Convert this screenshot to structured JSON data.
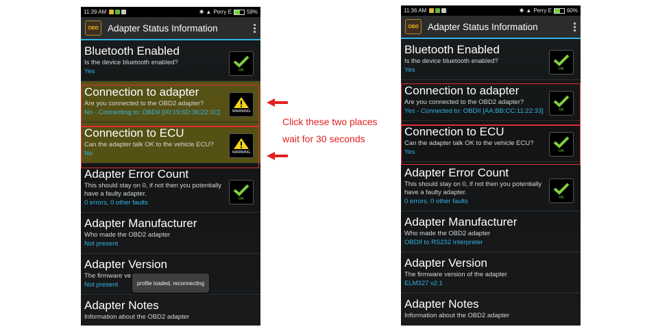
{
  "left_phone": {
    "statusbar": {
      "time": "11:39 AM",
      "carrier": "Perry E",
      "battery": "59%",
      "battery_level": 0.59
    },
    "actionbar": {
      "title": "Adapter Status Information",
      "logo_text": "OBD"
    },
    "rows": [
      {
        "title": "Bluetooth Enabled",
        "description": "Is the device bluetooth enabled?",
        "status": "Yes",
        "icon": "ok",
        "icon_label": "OK"
      },
      {
        "title": "Connection to adapter",
        "description": "Are you connected to the OBD2 adapter?",
        "status": "No - Connecting to: OBDII [00:19:6D:36:22:1C]",
        "icon": "warning",
        "icon_label": "WARNING"
      },
      {
        "title": "Connection to ECU",
        "description": "Can the adapter talk OK to the vehicle ECU?",
        "status": "No",
        "icon": "warning",
        "icon_label": "WARNING"
      },
      {
        "title": "Adapter Error Count",
        "description": "This should stay on 0, if not then you potentially have a faulty adapter.",
        "status": "0 errors, 0 other faults",
        "icon": "ok",
        "icon_label": "OK"
      },
      {
        "title": "Adapter Manufacturer",
        "description": "Who made the OBD2 adapter",
        "status": "Not present"
      },
      {
        "title": "Adapter Version",
        "description": "The firmware ve",
        "status": "Not present"
      },
      {
        "title": "Adapter Notes",
        "description": "Information about the OBD2 adapter"
      }
    ],
    "toast": "profile loaded, reconnecting"
  },
  "right_phone": {
    "statusbar": {
      "time": "11:36 AM",
      "carrier": "Perry E",
      "battery": "60%",
      "battery_level": 0.6
    },
    "actionbar": {
      "title": "Adapter Status Information",
      "logo_text": "OBD"
    },
    "rows": [
      {
        "title": "Bluetooth Enabled",
        "description": "Is the device bluetooth enabled?",
        "status": "Yes",
        "icon": "ok",
        "icon_label": "OK"
      },
      {
        "title": "Connection to adapter",
        "description": "Are you connected to the OBD2 adapter?",
        "status": "Yes - Connected to: OBDII [AA:BB:CC:11:22:33]",
        "icon": "ok",
        "icon_label": "OK"
      },
      {
        "title": "Connection to ECU",
        "description": "Can the adapter talk OK to the vehicle ECU?",
        "status": "Yes",
        "icon": "ok",
        "icon_label": "OK"
      },
      {
        "title": "Adapter Error Count",
        "description": "This should stay on 0, if not then you potentially have a faulty adapter.",
        "status": "0 errors, 0 other faults",
        "icon": "ok",
        "icon_label": "OK"
      },
      {
        "title": "Adapter Manufacturer",
        "description": "Who made the OBD2 adapter",
        "status": "OBDII to RS232 Interpreter"
      },
      {
        "title": "Adapter Version",
        "description": "The firmware version of the adapter",
        "status": "ELM327 v2.1"
      },
      {
        "title": "Adapter Notes",
        "description": "Information about the OBD2 adapter"
      }
    ]
  },
  "annotation": {
    "line1": "Click these two places",
    "line2": "wait for 30 seconds",
    "color": "#e02020"
  },
  "colors": {
    "accent": "#33b5e5",
    "ok": "#7ed040",
    "warning_bg": "#8c8214",
    "highlight": "#e03030"
  }
}
